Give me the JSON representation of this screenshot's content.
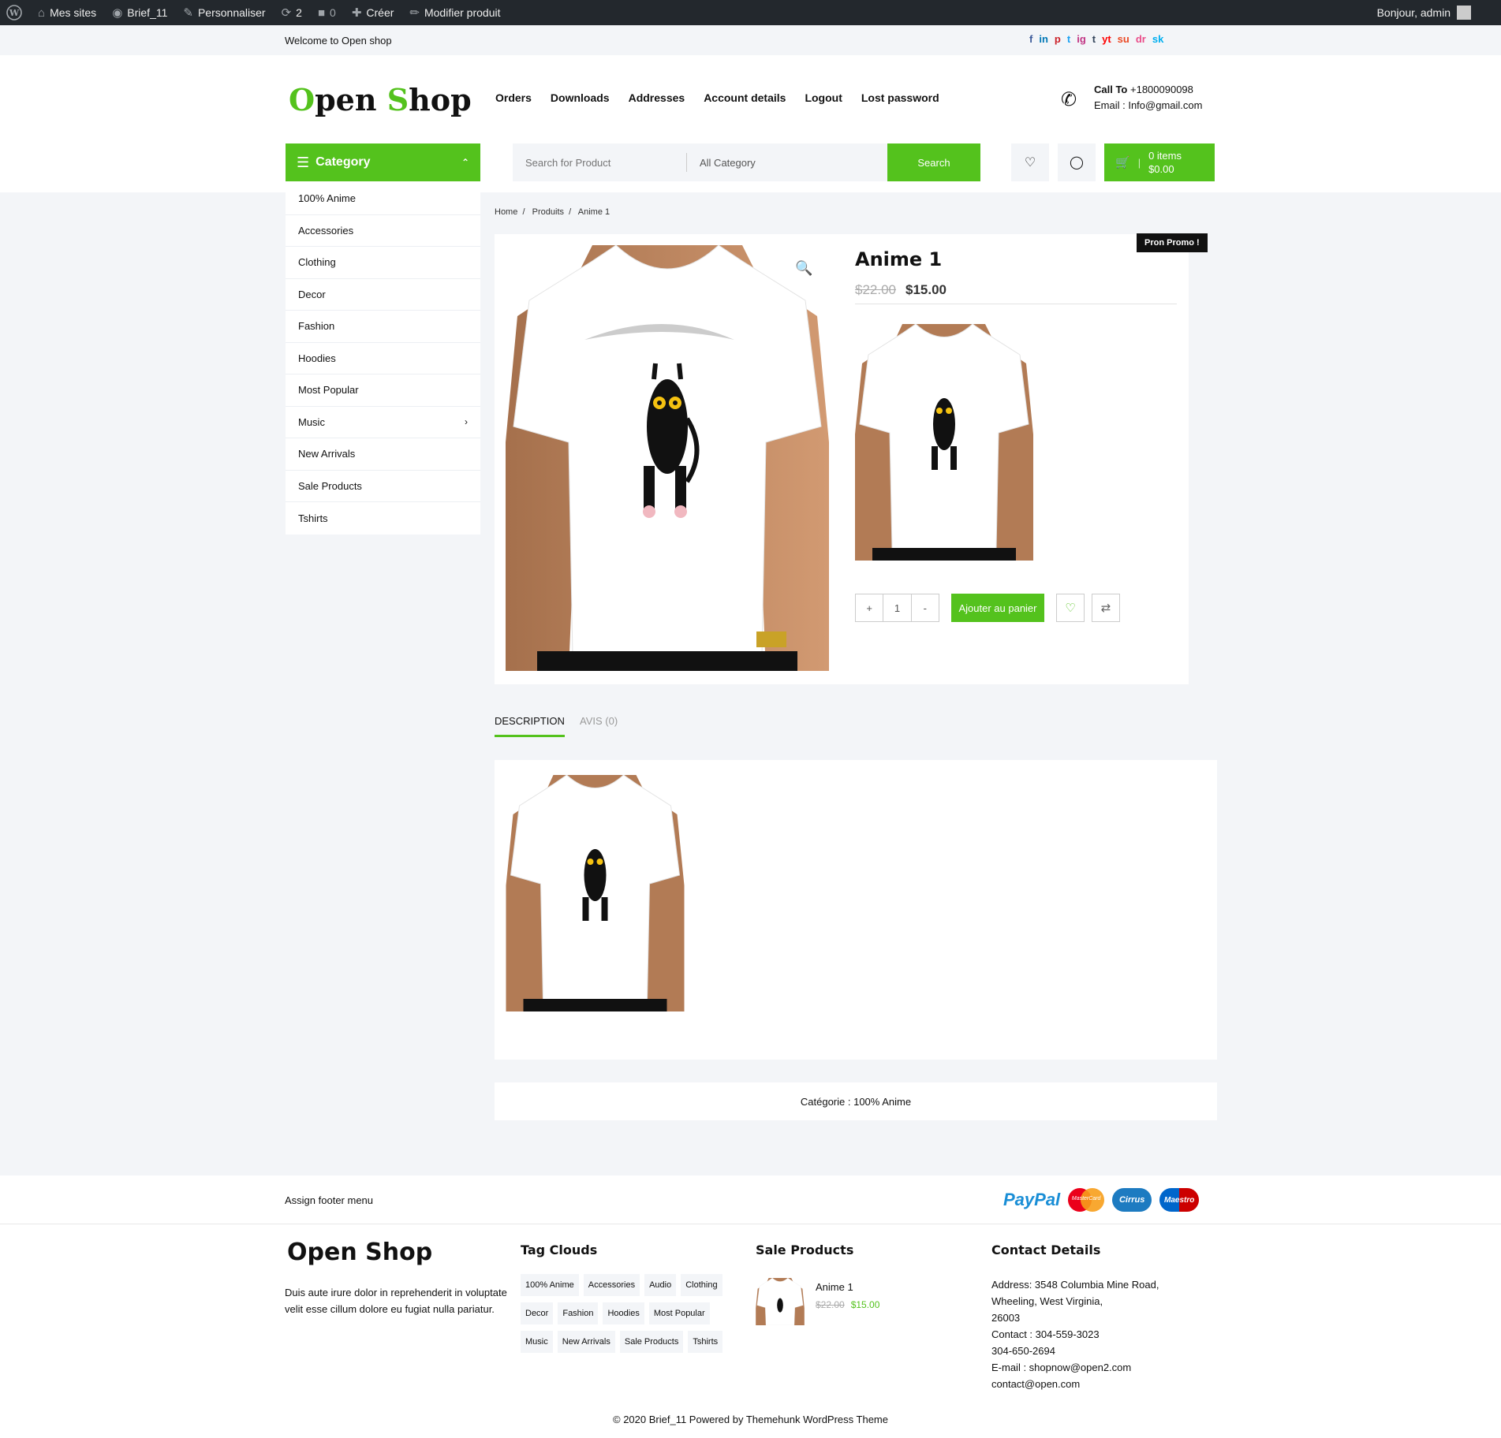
{
  "adminbar": {
    "items": [
      {
        "icon": "wordpress-icon",
        "label": ""
      },
      {
        "icon": "sites-icon",
        "label": "Mes sites"
      },
      {
        "icon": "dashboard-icon",
        "label": "Brief_11"
      },
      {
        "icon": "brush-icon",
        "label": "Personnaliser"
      },
      {
        "icon": "refresh-icon",
        "label": "2"
      },
      {
        "icon": "comment-icon",
        "label": "0"
      },
      {
        "icon": "plus-icon",
        "label": "Créer"
      },
      {
        "icon": "pencil-icon",
        "label": "Modifier produit"
      }
    ],
    "greeting": "Bonjour, admin"
  },
  "topbar": {
    "welcome": "Welcome to Open shop",
    "socials": [
      "f",
      "in",
      "p",
      "t",
      "ig",
      "t",
      "yt",
      "su",
      "dr",
      "sk"
    ]
  },
  "header": {
    "logo_first_letter": "O",
    "logo_rest1": "pen ",
    "logo_second_letter": "S",
    "logo_rest2": "hop",
    "nav": [
      "Orders",
      "Downloads",
      "Addresses",
      "Account details",
      "Logout",
      "Lost password"
    ],
    "call_label": "Call To",
    "call_number": "+1800090098",
    "email_line": "Email : Info@gmail.com",
    "category_label": "Category",
    "search_placeholder": "Search for Product",
    "all_category": "All Category",
    "search_button": "Search",
    "cart_items": "0 items",
    "cart_total": "$0.00"
  },
  "categories": [
    "100% Anime",
    "Accessories",
    "Clothing",
    "Decor",
    "Fashion",
    "Hoodies",
    "Most Popular",
    "Music",
    "New Arrivals",
    "Sale Products",
    "Tshirts"
  ],
  "breadcrumb": "Home  /   Produits  /   Anime 1",
  "product": {
    "promo": "Pron  Promo !",
    "title": "Anime 1",
    "old_price": "$22.00",
    "new_price": "$15.00",
    "qty_plus": "+",
    "qty_value": "1",
    "qty_minus": "-",
    "add_to_cart": "Ajouter au panier"
  },
  "tabs": {
    "description": "DESCRIPTION",
    "reviews": "AVIS (0)"
  },
  "category_line": "Catégorie : 100% Anime",
  "footer": {
    "assign_menu": "Assign footer menu",
    "payments": [
      "PayPal",
      "MasterCard",
      "Cirrus",
      "Maestro"
    ],
    "brand": "Open Shop",
    "description": "Duis aute irure dolor in reprehenderit in voluptate velit esse cillum dolore eu fugiat nulla pariatur.",
    "tag_heading": "Tag Clouds",
    "tags": [
      "100% Anime",
      "Accessories",
      "Audio",
      "Clothing",
      "Decor",
      "Fashion",
      "Hoodies",
      "Most Popular",
      "Music",
      "New Arrivals",
      "Sale Products",
      "Tshirts"
    ],
    "sale_heading": "Sale Products",
    "sale_item_name": "Anime 1",
    "sale_old_price": "$22.00",
    "sale_new_price": "$15.00",
    "contact_heading": "Contact Details",
    "contact_lines": [
      "Address: 3548 Columbia Mine Road,",
      "Wheeling, West Virginia,",
      "26003",
      "Contact : 304-559-3023",
      "304-650-2694",
      "E-mail : shopnow@open2.com",
      "contact@open.com"
    ],
    "copyright": "© 2020 Brief_11 Powered by Themehunk WordPress Theme"
  },
  "colors": {
    "accent": "#54c21d",
    "adminbar": "#23282d",
    "background": "#f3f5f8"
  }
}
